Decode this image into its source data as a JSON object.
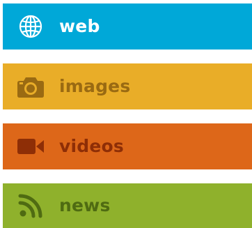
{
  "menu": {
    "items": [
      {
        "label": "web",
        "icon": "globe-icon",
        "background": "#00a8d8",
        "text_color": "#ffffff"
      },
      {
        "label": "images",
        "icon": "camera-icon",
        "background": "#e9ad28",
        "text_color": "#9a6a12"
      },
      {
        "label": "videos",
        "icon": "video-camera-icon",
        "background": "#dd6719",
        "text_color": "#8e2e06"
      },
      {
        "label": "news",
        "icon": "rss-icon",
        "background": "#8fb12c",
        "text_color": "#4f6b12"
      }
    ]
  }
}
